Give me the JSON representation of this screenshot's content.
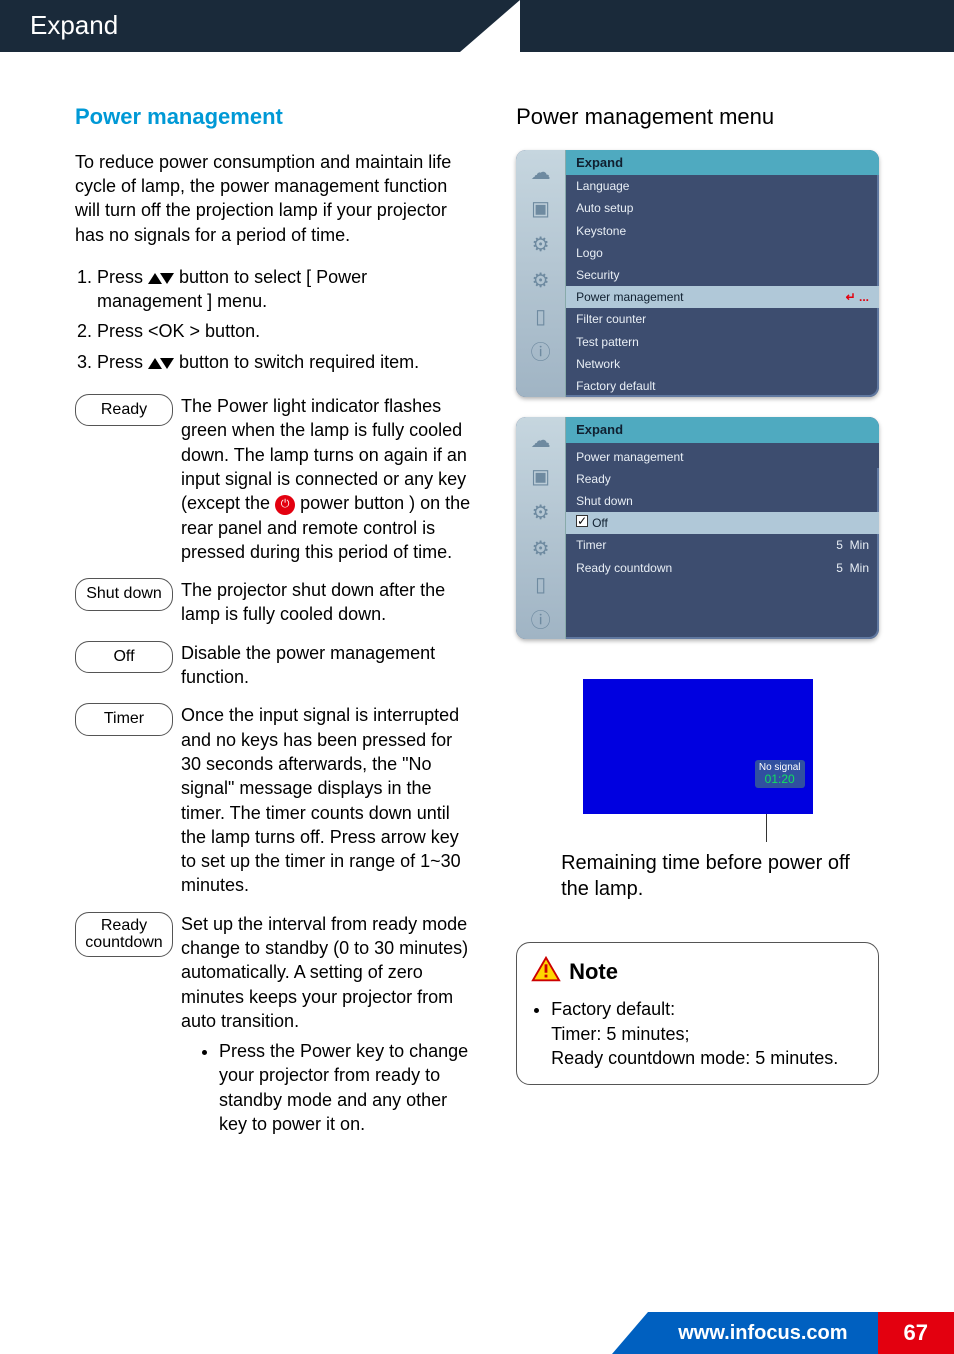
{
  "tab_title": "Expand",
  "left": {
    "heading": "Power management",
    "intro": "To reduce power consumption and maintain life cycle of lamp, the power management function will turn off the projection lamp if your projector has no signals for a period of time.",
    "steps": {
      "s1a": "Press ",
      "s1b": " button to select [ Power management ] menu.",
      "s2": "Press <OK > button.",
      "s3a": "Press ",
      "s3b": " button to switch required item."
    },
    "options": {
      "ready": {
        "label": "Ready",
        "desc_a": "The Power light indicator flashes green when the lamp is fully cooled down. The lamp turns on again if an input signal is connected or any key (except the ",
        "desc_b": " power button ) on the rear panel and remote control is pressed during this period of time."
      },
      "shutdown": {
        "label": "Shut down",
        "desc": "The projector shut down after the lamp is fully cooled down."
      },
      "off": {
        "label": "Off",
        "desc": "Disable the power management function."
      },
      "timer": {
        "label": "Timer",
        "desc": "Once the input signal is interrupted and no keys has been pressed for 30 seconds afterwards, the \"No signal\" message displays in the timer. The timer counts down until the lamp turns off. Press arrow key to set up the timer in range of 1~30 minutes."
      },
      "readycd": {
        "label_l1": "Ready",
        "label_l2": "countdown",
        "desc": "Set up the interval from ready mode change to standby (0 to 30 minutes) automatically. A setting of zero minutes keeps your projector from auto transition.",
        "bullet": "Press the Power key to change your projector from ready to standby mode and any other key to power it on."
      }
    }
  },
  "right": {
    "heading": "Power management menu",
    "menu1": {
      "header": "Expand",
      "items": [
        "Language",
        "Auto setup",
        "Keystone",
        "Logo",
        "Security"
      ],
      "selected": "Power management",
      "selected_icon": "↵  ...",
      "items_after": [
        "Filter counter",
        "Test pattern",
        "Network",
        "Factory default"
      ]
    },
    "menu2": {
      "header": "Expand",
      "sub": "Power management",
      "rows": [
        {
          "label": "Ready",
          "val": ""
        },
        {
          "label": "Shut down",
          "val": ""
        }
      ],
      "sel_label": "Off",
      "rows2": [
        {
          "label": "Timer",
          "val": "5",
          "unit": "Min"
        },
        {
          "label": "Ready countdown",
          "val": "5",
          "unit": "Min"
        }
      ]
    },
    "timer_badge": {
      "line1": "No signal",
      "line2": "01:20"
    },
    "caption": "Remaining time before power off the lamp.",
    "note": {
      "title": "Note",
      "text": "Factory default:\nTimer: 5 minutes;\nReady countdown mode: 5 minutes."
    }
  },
  "footer": {
    "url": "www.infocus.com",
    "page": "67"
  }
}
